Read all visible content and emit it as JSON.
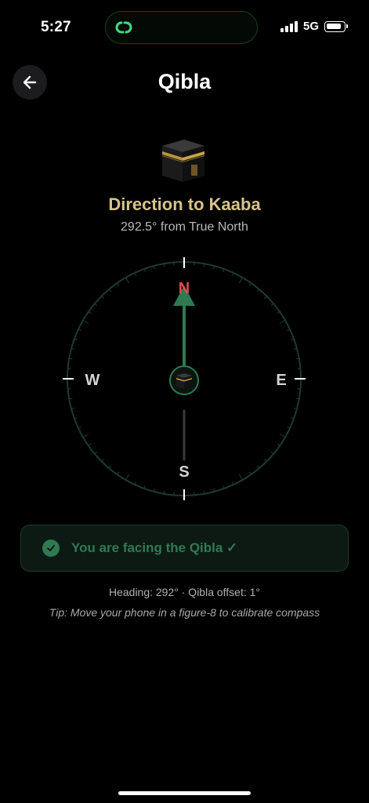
{
  "status_bar": {
    "time": "5:27",
    "network": "5G",
    "island_icon": "link-rings-icon"
  },
  "header": {
    "title": "Qibla",
    "back_icon": "arrow-left-icon"
  },
  "hero": {
    "icon": "kaaba-icon",
    "title": "Direction to Kaaba",
    "subtitle": "292.5° from True North"
  },
  "compass": {
    "north": "N",
    "south": "S",
    "east": "E",
    "west": "W",
    "needle_bearing_deg": 0,
    "center_icon": "kaaba-icon"
  },
  "status_card": {
    "icon": "check-circle-icon",
    "text": "You are facing the Qibla ✓"
  },
  "info": {
    "heading_line": "Heading: 292° · Qibla offset: 1°",
    "tip": "Tip: Move your phone in a figure-8 to calibrate compass"
  },
  "colors": {
    "accent_green": "#2f7a52",
    "gold": "#d8c38a",
    "north_red": "#e5484d",
    "background": "#000000"
  }
}
